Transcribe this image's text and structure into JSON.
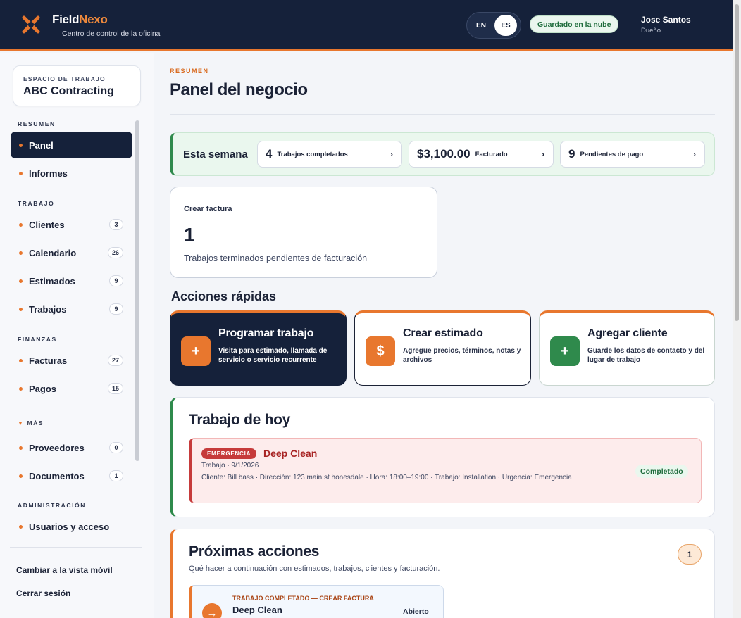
{
  "app": {
    "brand_part1": "Field",
    "brand_part2": "Nexo",
    "subtitle": "Centro de control de la oficina",
    "lang_en": "EN",
    "lang_es": "ES",
    "cloud_status": "Guardado en la nube",
    "user_name": "Jose Santos",
    "user_role": "Dueño",
    "colors": {
      "navy": "#15213a",
      "accent": "#e8772e",
      "green": "#2f8a4c",
      "red": "#c63b3b"
    }
  },
  "sidebar": {
    "workspace_label": "ESPACIO DE TRABAJO",
    "workspace_name": "ABC Contracting",
    "sections": {
      "resumen": "RESUMEN",
      "trabajo": "TRABAJO",
      "finanzas": "FINANZAS",
      "mas": "MÁS",
      "administracion": "ADMINISTRACIÓN"
    },
    "items": [
      {
        "label": "Panel"
      },
      {
        "label": "Informes"
      },
      {
        "label": "Clientes",
        "count": "3"
      },
      {
        "label": "Calendario",
        "count": "26"
      },
      {
        "label": "Estimados",
        "count": "9"
      },
      {
        "label": "Trabajos",
        "count": "9"
      },
      {
        "label": "Facturas",
        "count": "27"
      },
      {
        "label": "Pagos",
        "count": "15"
      },
      {
        "label": "Proveedores",
        "count": "0"
      },
      {
        "label": "Documentos",
        "count": "1"
      },
      {
        "label": "Usuarios y acceso"
      }
    ],
    "mobile_view": "Cambiar a la vista móvil",
    "logout": "Cerrar sesión"
  },
  "main": {
    "eyebrow": "RESUMEN",
    "title": "Panel del negocio",
    "week": {
      "label": "Esta semana",
      "stats": [
        {
          "value": "4",
          "label": "Trabajos completados"
        },
        {
          "value": "$3,100.00",
          "label": "Facturado"
        },
        {
          "value": "9",
          "label": "Pendientes de pago"
        }
      ]
    },
    "invoice_card": {
      "title": "Crear factura",
      "count": "1",
      "desc": "Trabajos terminados pendientes de facturación"
    },
    "quick_actions": {
      "title": "Acciones rápidas",
      "items": [
        {
          "title": "Programar trabajo",
          "desc": "Visita para estimado, llamada de servicio o servicio recurrente",
          "icon": "plus-icon"
        },
        {
          "title": "Crear estimado",
          "desc": "Agregue precios, términos, notas y archivos",
          "icon": "dollar-icon"
        },
        {
          "title": "Agregar cliente",
          "desc": "Guarde los datos de contacto y del lugar de trabajo",
          "icon": "plus-icon"
        }
      ]
    },
    "today": {
      "title": "Trabajo de hoy",
      "job": {
        "badge": "EMERGENCIA",
        "name": "Deep Clean",
        "meta": "Trabajo · 9/1/2026",
        "detail": "Cliente: Bill bass · Dirección: 123 main st honesdale · Hora: 18:00–19:00 · Trabajo: Installation · Urgencia: Emergencia",
        "status": "Completado"
      }
    },
    "next": {
      "title": "Próximas acciones",
      "subtitle": "Qué hacer a continuación con estimados, trabajos, clientes y facturación.",
      "count": "1",
      "action": {
        "eyebrow": "TRABAJO COMPLETADO — CREAR FACTURA",
        "name": "Deep Clean",
        "status": "Abierto"
      }
    }
  }
}
